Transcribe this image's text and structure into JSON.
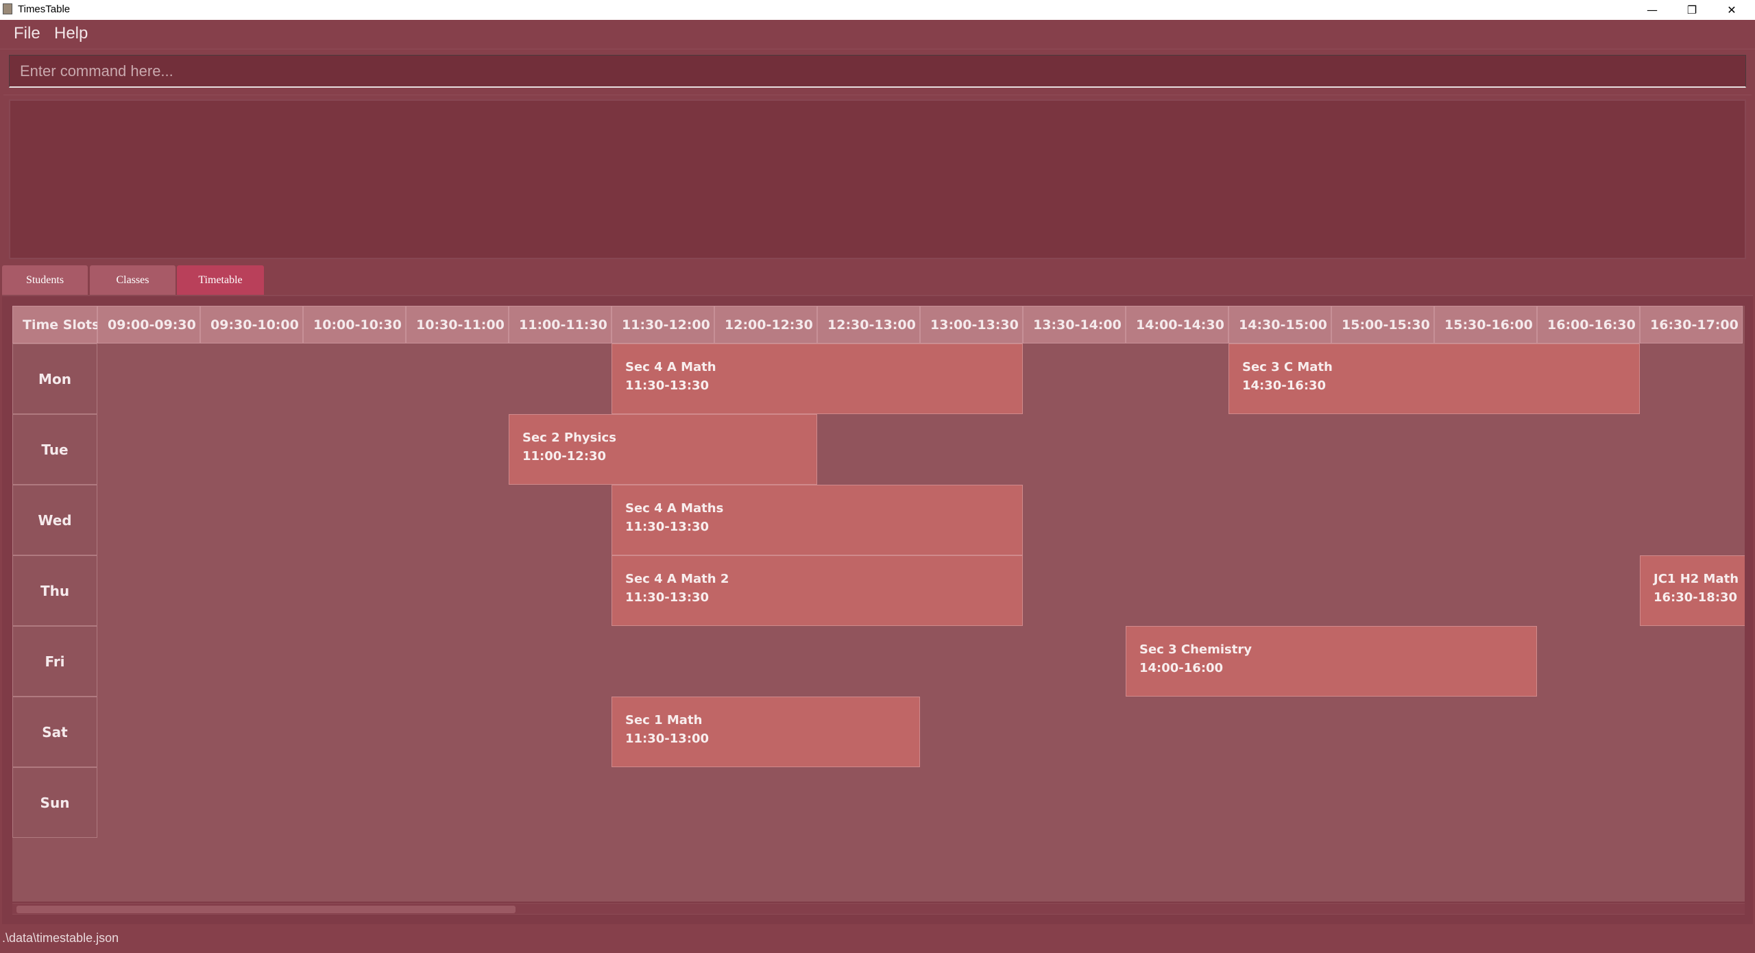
{
  "window": {
    "title": "TimesTable",
    "controls": [
      "minimize-icon",
      "restore-icon",
      "close-icon"
    ]
  },
  "menu": {
    "file": "File",
    "help": "Help"
  },
  "command": {
    "placeholder": "Enter command here...",
    "value": ""
  },
  "result": {
    "text": ""
  },
  "tabs": [
    {
      "label": "Students",
      "active": false
    },
    {
      "label": "Classes",
      "active": false
    },
    {
      "label": "Timetable",
      "active": true
    }
  ],
  "timetable": {
    "corner": "Time Slots",
    "slots": [
      "09:00-09:30",
      "09:30-10:00",
      "10:00-10:30",
      "10:30-11:00",
      "11:00-11:30",
      "11:30-12:00",
      "12:00-12:30",
      "12:30-13:00",
      "13:00-13:30",
      "13:30-14:00",
      "14:00-14:30",
      "14:30-15:00",
      "15:00-15:30",
      "15:30-16:00",
      "16:00-16:30",
      "16:30-17:00"
    ],
    "days": [
      "Mon",
      "Tue",
      "Wed",
      "Thu",
      "Fri",
      "Sat",
      "Sun"
    ],
    "classes": [
      {
        "day": "Mon",
        "name": "Sec 4 A Math",
        "time": "11:30-13:30"
      },
      {
        "day": "Mon",
        "name": "Sec 3 C Math",
        "time": "14:30-16:30"
      },
      {
        "day": "Tue",
        "name": "Sec 2 Physics",
        "time": "11:00-12:30"
      },
      {
        "day": "Wed",
        "name": "Sec 4 A Maths",
        "time": "11:30-13:30"
      },
      {
        "day": "Thu",
        "name": "Sec 4 A Math 2",
        "time": "11:30-13:30"
      },
      {
        "day": "Thu",
        "name": "JC1 H2 Math",
        "time": "16:30-18:30"
      },
      {
        "day": "Fri",
        "name": "Sec 3 Chemistry",
        "time": "14:00-16:00"
      },
      {
        "day": "Sat",
        "name": "Sec 1 Math",
        "time": "11:30-13:00"
      }
    ]
  },
  "colors": {
    "background": "#86404b",
    "command_box": "#722f3a",
    "tab_active": "#b9405a",
    "tab": "#a85a67",
    "header_cell": "#b87c83",
    "class_block": "#c06666",
    "grid": "#91545c"
  },
  "status": {
    "path": ".\\data\\timestable.json"
  }
}
